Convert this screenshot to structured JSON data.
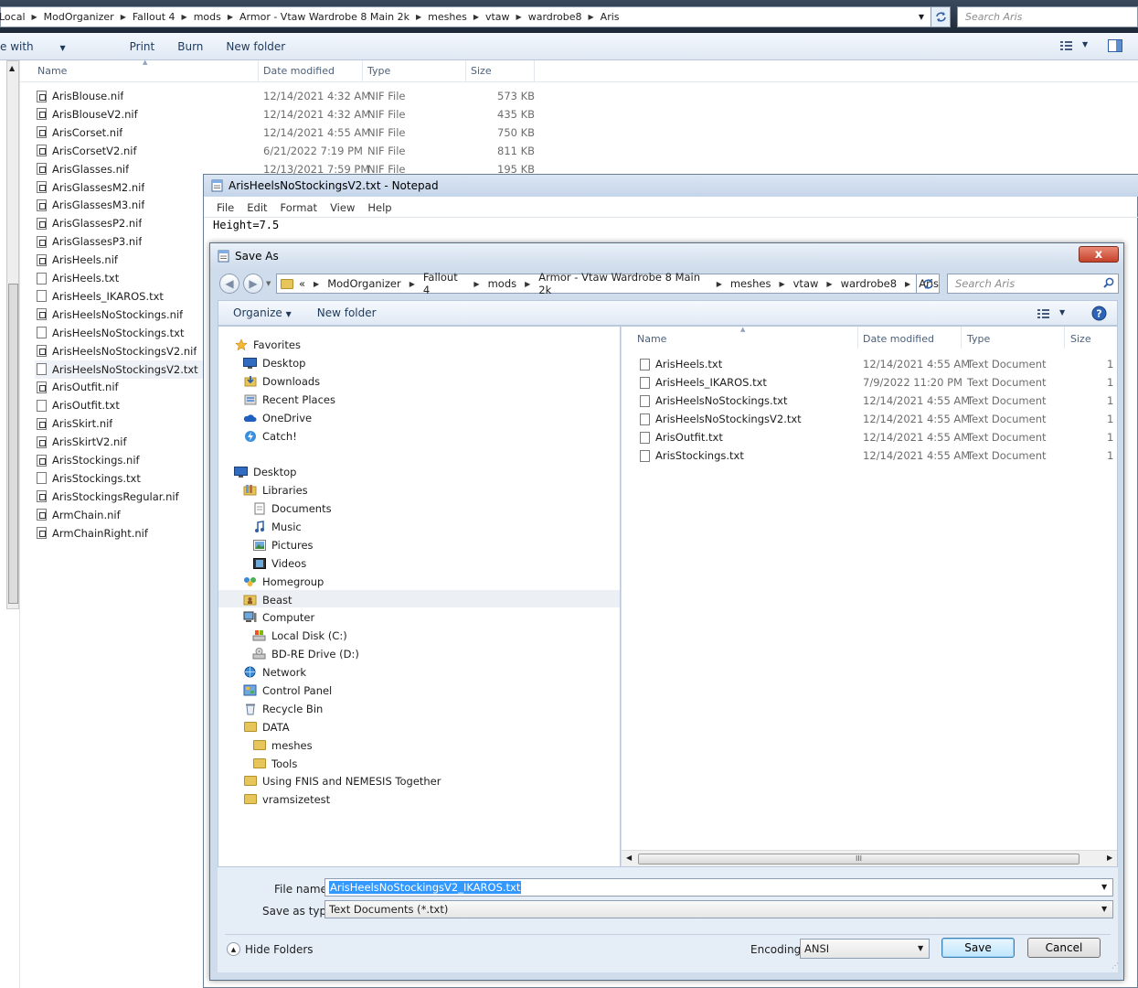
{
  "background_explorer": {
    "breadcrumbs": [
      "Local",
      "ModOrganizer",
      "Fallout 4",
      "mods",
      "Armor - Vtaw Wardrobe 8 Main 2k",
      "meshes",
      "vtaw",
      "wardrobe8",
      "Aris"
    ],
    "search_placeholder": "Search Aris",
    "toolbar": [
      "e with",
      "Print",
      "Burn",
      "New folder"
    ],
    "columns": [
      "Name",
      "Date modified",
      "Type",
      "Size"
    ],
    "files": [
      {
        "name": "ArisBlouse.nif",
        "date": "12/14/2021 4:32 AM",
        "type": "NIF File",
        "size": "573 KB"
      },
      {
        "name": "ArisBlouseV2.nif",
        "date": "12/14/2021 4:32 AM",
        "type": "NIF File",
        "size": "435 KB"
      },
      {
        "name": "ArisCorset.nif",
        "date": "12/14/2021 4:55 AM",
        "type": "NIF File",
        "size": "750 KB"
      },
      {
        "name": "ArisCorsetV2.nif",
        "date": "6/21/2022 7:19 PM",
        "type": "NIF File",
        "size": "811 KB"
      },
      {
        "name": "ArisGlasses.nif",
        "date": "12/13/2021 7:59 PM",
        "type": "NIF File",
        "size": "195 KB"
      },
      {
        "name": "ArisGlassesM2.nif"
      },
      {
        "name": "ArisGlassesM3.nif"
      },
      {
        "name": "ArisGlassesP2.nif"
      },
      {
        "name": "ArisGlassesP3.nif"
      },
      {
        "name": "ArisHeels.nif"
      },
      {
        "name": "ArisHeels.txt"
      },
      {
        "name": "ArisHeels_IKAROS.txt"
      },
      {
        "name": "ArisHeelsNoStockings.nif"
      },
      {
        "name": "ArisHeelsNoStockings.txt"
      },
      {
        "name": "ArisHeelsNoStockingsV2.nif"
      },
      {
        "name": "ArisHeelsNoStockingsV2.txt"
      },
      {
        "name": "ArisOutfit.nif"
      },
      {
        "name": "ArisOutfit.txt"
      },
      {
        "name": "ArisSkirt.nif"
      },
      {
        "name": "ArisSkirtV2.nif"
      },
      {
        "name": "ArisStockings.nif"
      },
      {
        "name": "ArisStockings.txt"
      },
      {
        "name": "ArisStockingsRegular.nif"
      },
      {
        "name": "ArmChain.nif"
      },
      {
        "name": "ArmChainRight.nif"
      }
    ]
  },
  "notepad": {
    "title": "ArisHeelsNoStockingsV2.txt - Notepad",
    "menu": [
      "File",
      "Edit",
      "Format",
      "View",
      "Help"
    ],
    "content": "Height=7.5"
  },
  "save_dialog": {
    "title": "Save As",
    "close_glyph": "x",
    "breadcrumbs": [
      "«",
      "ModOrganizer",
      "Fallout 4",
      "mods",
      "Armor - Vtaw Wardrobe 8 Main 2k",
      "meshes",
      "vtaw",
      "wardrobe8",
      "Aris"
    ],
    "search_placeholder": "Search Aris",
    "organize_label": "Organize",
    "new_folder_label": "New folder",
    "nav": [
      {
        "label": "Favorites",
        "icon": "star-icon"
      },
      {
        "label": "Desktop",
        "icon": "desktop-icon"
      },
      {
        "label": "Downloads",
        "icon": "downloads-icon"
      },
      {
        "label": "Recent Places",
        "icon": "recent-places-icon"
      },
      {
        "label": "OneDrive",
        "icon": "onedrive-icon"
      },
      {
        "label": "Catch!",
        "icon": "catch-icon"
      },
      {
        "label": "Desktop",
        "icon": "desktop-icon"
      },
      {
        "label": "Libraries",
        "icon": "libraries-icon"
      },
      {
        "label": "Documents",
        "icon": "documents-icon"
      },
      {
        "label": "Music",
        "icon": "music-icon"
      },
      {
        "label": "Pictures",
        "icon": "pictures-icon"
      },
      {
        "label": "Videos",
        "icon": "videos-icon"
      },
      {
        "label": "Homegroup",
        "icon": "homegroup-icon"
      },
      {
        "label": "Beast",
        "icon": "user-folder-icon"
      },
      {
        "label": "Computer",
        "icon": "computer-icon"
      },
      {
        "label": "Local Disk (C:)",
        "icon": "drive-icon"
      },
      {
        "label": "BD-RE Drive (D:)",
        "icon": "disc-drive-icon"
      },
      {
        "label": "Network",
        "icon": "network-icon"
      },
      {
        "label": "Control Panel",
        "icon": "control-panel-icon"
      },
      {
        "label": "Recycle Bin",
        "icon": "recycle-bin-icon"
      },
      {
        "label": "DATA",
        "icon": "folder-icon"
      },
      {
        "label": "meshes",
        "icon": "folder-icon"
      },
      {
        "label": "Tools",
        "icon": "folder-icon"
      },
      {
        "label": "Using FNIS and NEMESIS Together",
        "icon": "folder-icon"
      },
      {
        "label": "vramsizetest",
        "icon": "folder-icon"
      }
    ],
    "columns": [
      "Name",
      "Date modified",
      "Type",
      "Size"
    ],
    "files": [
      {
        "name": "ArisHeels.txt",
        "date": "12/14/2021 4:55 AM",
        "type": "Text Document",
        "size": "1"
      },
      {
        "name": "ArisHeels_IKAROS.txt",
        "date": "7/9/2022 11:20 PM",
        "type": "Text Document",
        "size": "1"
      },
      {
        "name": "ArisHeelsNoStockings.txt",
        "date": "12/14/2021 4:55 AM",
        "type": "Text Document",
        "size": "1"
      },
      {
        "name": "ArisHeelsNoStockingsV2.txt",
        "date": "12/14/2021 4:55 AM",
        "type": "Text Document",
        "size": "1"
      },
      {
        "name": "ArisOutfit.txt",
        "date": "12/14/2021 4:55 AM",
        "type": "Text Document",
        "size": "1"
      },
      {
        "name": "ArisStockings.txt",
        "date": "12/14/2021 4:55 AM",
        "type": "Text Document",
        "size": "1"
      }
    ],
    "scroll_grip": "III",
    "file_name_label": "File name:",
    "file_name_value": "ArisHeelsNoStockingsV2_IKAROS.txt",
    "save_as_type_label": "Save as type:",
    "save_as_type_value": "Text Documents (*.txt)",
    "hide_folders_label": "Hide Folders",
    "encoding_label": "Encoding:",
    "encoding_value": "ANSI",
    "save_label": "Save",
    "cancel_label": "Cancel"
  }
}
